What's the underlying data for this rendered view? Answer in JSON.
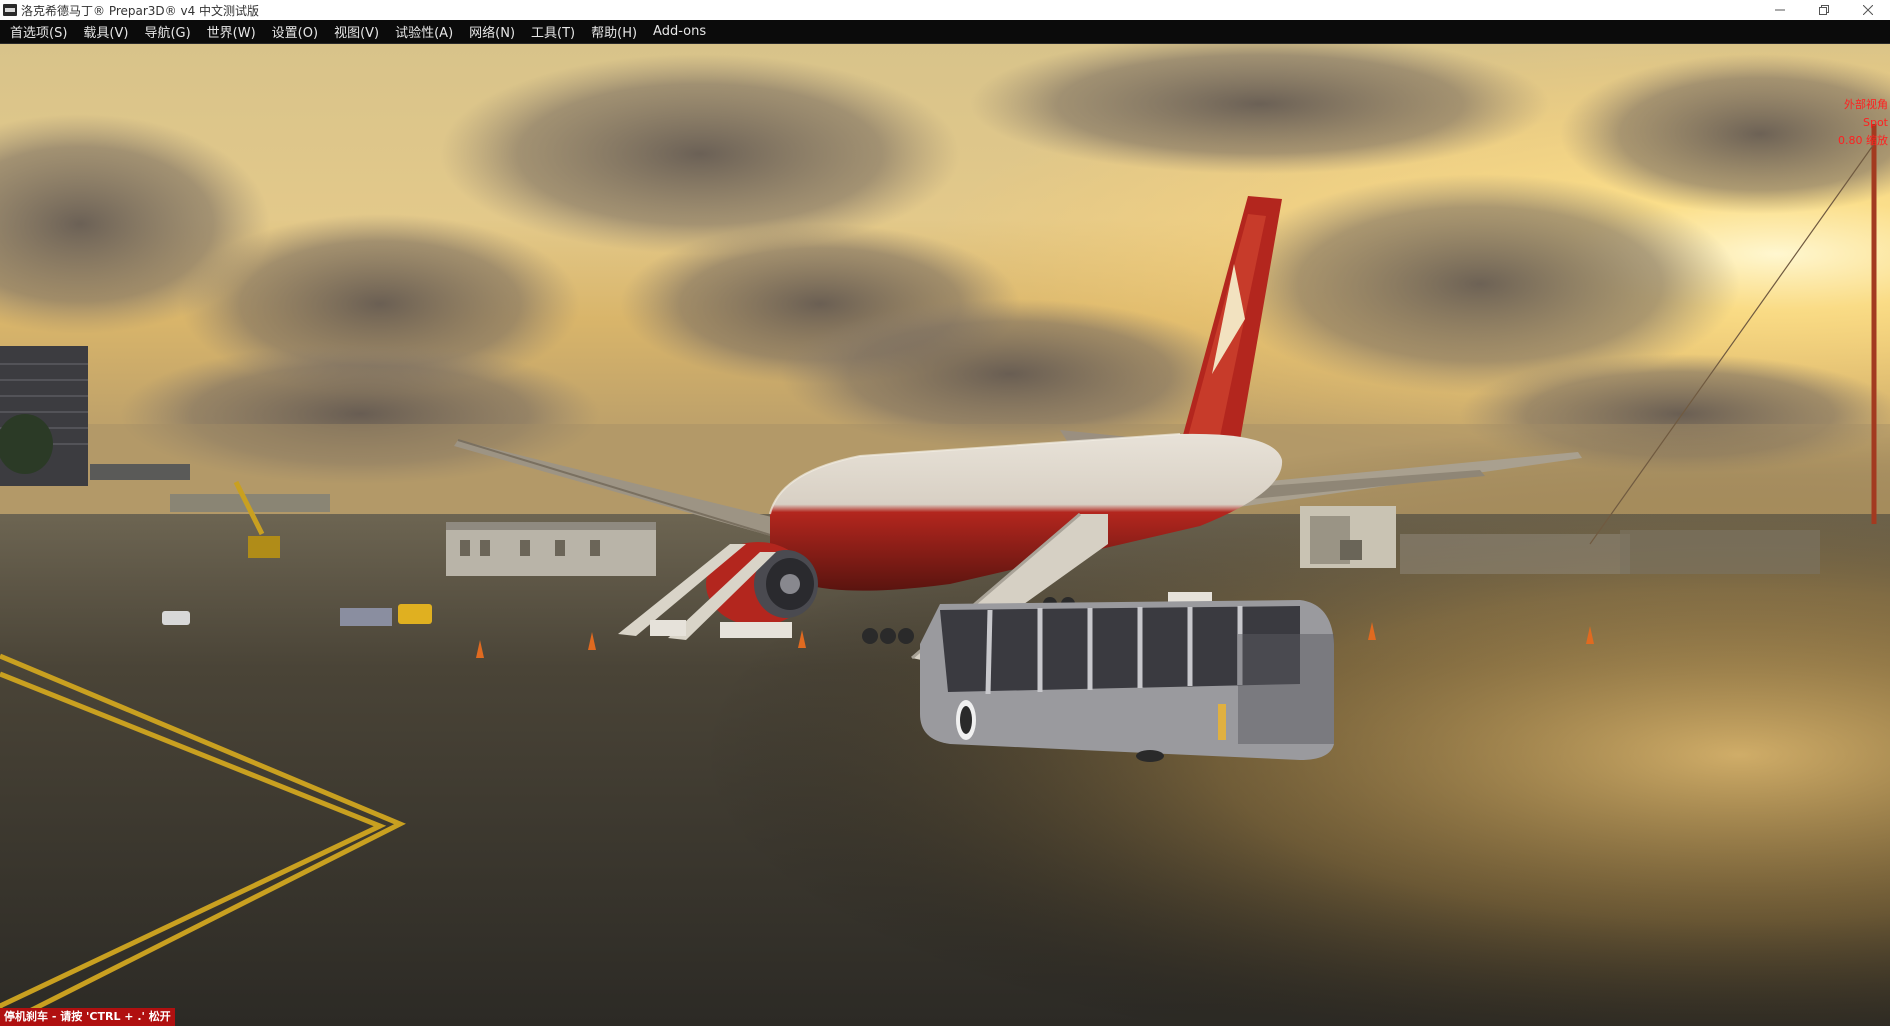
{
  "window": {
    "title": "洛克希德马丁® Prepar3D® v4 中文测试版",
    "controls": [
      "minimize",
      "restore",
      "close"
    ]
  },
  "menu": {
    "items": [
      {
        "label": "首选项(S)"
      },
      {
        "label": "载具(V)"
      },
      {
        "label": "导航(G)"
      },
      {
        "label": "世界(W)"
      },
      {
        "label": "设置(O)"
      },
      {
        "label": "视图(V)"
      },
      {
        "label": "试验性(A)"
      },
      {
        "label": "网络(N)"
      },
      {
        "label": "工具(T)"
      },
      {
        "label": "帮助(H)"
      },
      {
        "label": "Add-ons"
      }
    ]
  },
  "overlay": {
    "view_mode": "外部视角",
    "view_name": "Spot",
    "zoom": "0.80 缩放"
  },
  "status": {
    "message": "停机刹车 - 请按 'CTRL + .' 松开"
  },
  "colors": {
    "overlay_text": "#ff2020",
    "status_bg": "#b01010",
    "aircraft_livery": "#b3261e"
  },
  "icons": {
    "app": "prepar3d-app-icon",
    "minimize": "minimize-icon",
    "restore": "restore-icon",
    "close": "close-icon"
  }
}
